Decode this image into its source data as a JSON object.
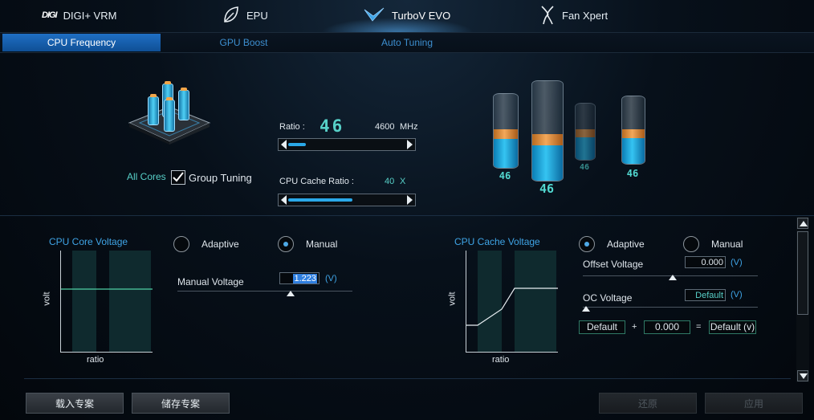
{
  "nav": {
    "items": [
      {
        "label": "DIGI+ VRM",
        "brand": "DIGI"
      },
      {
        "label": "EPU"
      },
      {
        "label": "TurboV EVO"
      },
      {
        "label": "Fan Xpert"
      }
    ],
    "active_index": 2
  },
  "tabs": {
    "items": [
      "CPU Frequency",
      "GPU Boost",
      "Auto Tuning"
    ],
    "active_index": 0
  },
  "frequency": {
    "ratio_label": "Ratio :",
    "ratio_value": "46",
    "mhz_value": "4600",
    "mhz_unit": "MHz",
    "ratio_slider_level": 0.15,
    "cache_label": "CPU Cache Ratio :",
    "cache_value": "40",
    "cache_unit": "X",
    "cache_slider_level": 0.55,
    "all_cores_label": "All Cores",
    "group_tuning_label": "Group Tuning",
    "group_tuning_checked": true
  },
  "core_values": {
    "main": "46",
    "small_1": "46",
    "small_2": "46",
    "small_3": "46"
  },
  "core_voltage": {
    "title": "CPU Core Voltage",
    "axis_y": "volt",
    "axis_x": "ratio",
    "adaptive_label": "Adaptive",
    "manual_label": "Manual",
    "selected": "manual",
    "manual_voltage_label": "Manual Voltage",
    "manual_voltage_value": "1.223",
    "unit": "(V)"
  },
  "cache_voltage": {
    "title": "CPU Cache Voltage",
    "axis_y": "volt",
    "axis_x": "ratio",
    "adaptive_label": "Adaptive",
    "manual_label": "Manual",
    "selected": "adaptive",
    "offset_label": "Offset Voltage",
    "offset_value": "0.000",
    "offset_unit": "(V)",
    "oc_label": "OC Voltage",
    "oc_value": "Default",
    "oc_unit": "(V)",
    "sum_a": "Default",
    "sum_plus": "+",
    "sum_b": "0.000",
    "sum_eq": "=",
    "sum_result": "Default (v)"
  },
  "buttons": {
    "load": "载入专案",
    "save": "储存专案",
    "undo": "还原",
    "apply": "应用"
  },
  "colors": {
    "accent": "#1f6fc4",
    "value_cyan": "#57d0c8",
    "title_blue": "#3fa4e6",
    "bar_blue": "#2aa8e8",
    "band_orange": "#f3a85a"
  }
}
